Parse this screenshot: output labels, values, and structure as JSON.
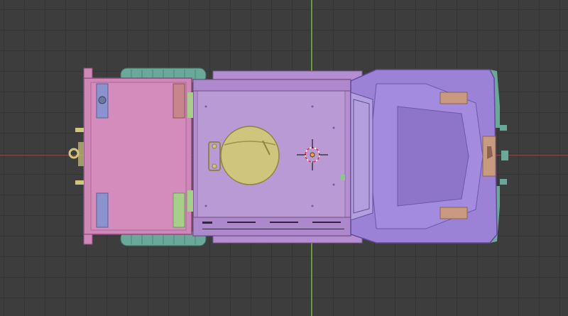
{
  "viewport": {
    "view": "top-orthographic",
    "background": "#3d3d3d",
    "grid_color": "#353535",
    "axis_colors": {
      "x": "#8b4a4a",
      "y": "#6f9a3a"
    }
  },
  "model": {
    "object": "armored-vehicle-top-view",
    "colors": {
      "rear_compartment": "#cf86b8",
      "cabin": "#b48ed0",
      "hood": "#9c82d6",
      "wheels": "#6aa99a",
      "hatch": "#cfc57d",
      "tail_lights_blue": "#8b93cf",
      "tail_light_red": "#c6868b",
      "tail_light_green": "#a8cf8a",
      "mirror_pads": "#c89a80"
    }
  },
  "origin_marker": {
    "icon": "object-origin-icon"
  },
  "cursor_3d": {
    "icon": "3d-cursor-icon"
  }
}
